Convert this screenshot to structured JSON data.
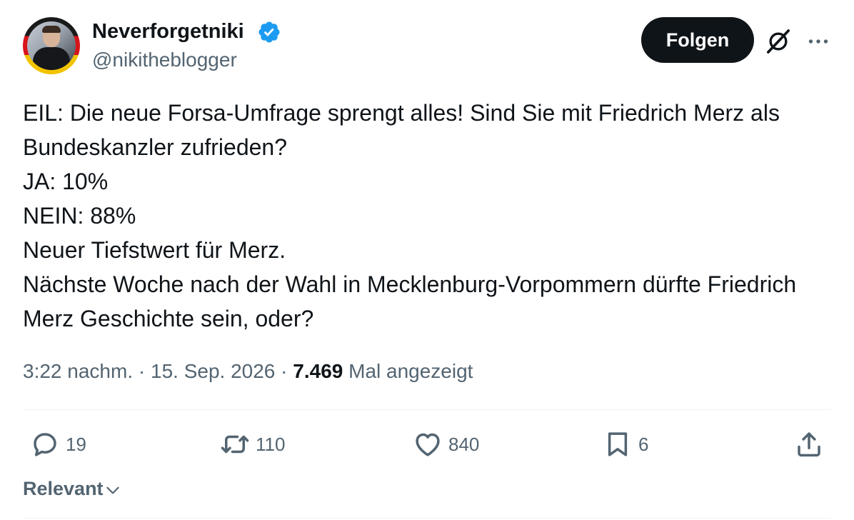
{
  "user": {
    "display_name": "Neverforgetniki",
    "handle": "@nikitheblogger",
    "verified_color": "#1d9bf0"
  },
  "header": {
    "follow_label": "Folgen",
    "icons": [
      "grok-icon",
      "more-icon"
    ]
  },
  "tweet": {
    "lines": [
      "EIL: Die neue Forsa-Umfrage sprengt alles! Sind Sie mit Friedrich Merz als Bundeskanzler zufrieden?",
      "JA: 10%",
      "NEIN: 88%",
      "Neuer Tiefstwert für Merz.",
      "Nächste Woche nach der Wahl in Mecklenburg-Vorpommern dürfte Friedrich Merz Geschichte sein, oder?"
    ]
  },
  "meta": {
    "time": "3:22 nachm.",
    "separator": "·",
    "date": "15. Sep. 2026",
    "views": "7.469",
    "views_label": "Mal angezeigt"
  },
  "actions": {
    "replies": "19",
    "retweets": "110",
    "likes": "840",
    "bookmarks": "6"
  },
  "sort": {
    "label": "Relevant"
  },
  "colors": {
    "text": "#0f1419",
    "secondary": "#536471",
    "divider": "#eff3f4",
    "button_bg": "#0f1419"
  }
}
